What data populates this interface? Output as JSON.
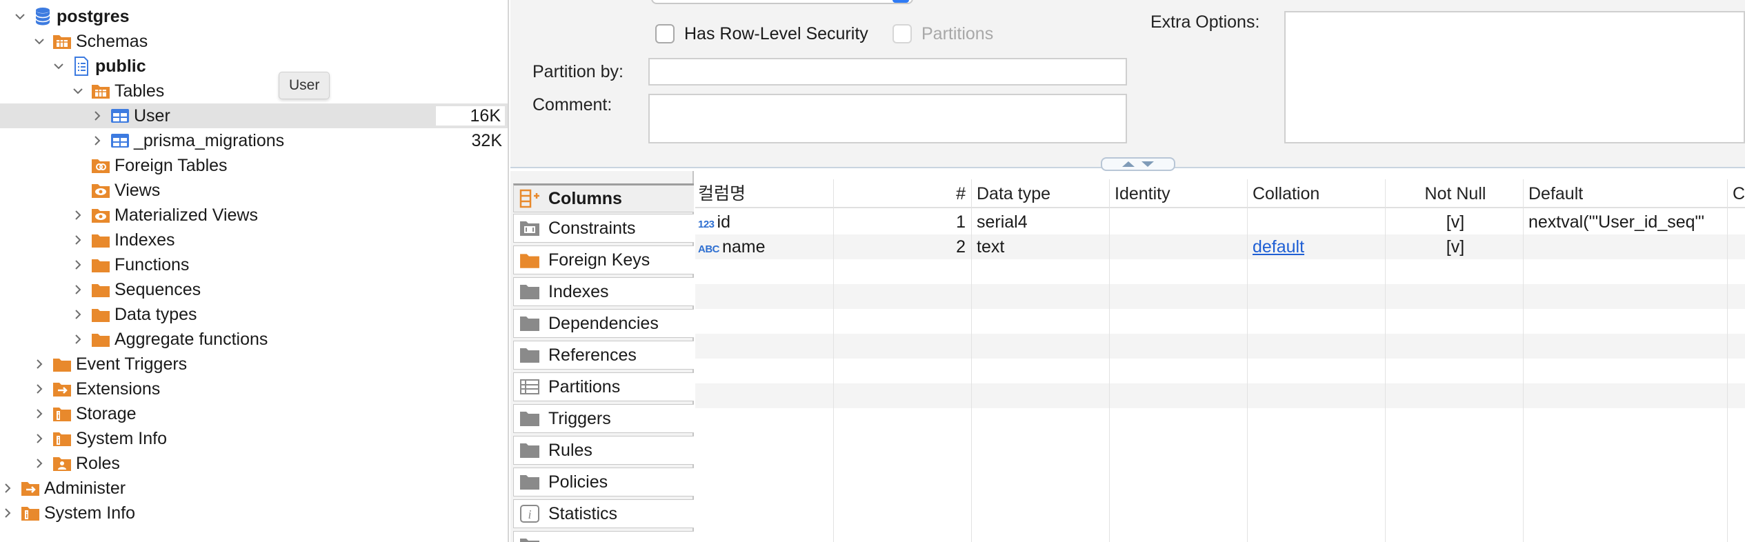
{
  "colors": {
    "folder": "#e8892c",
    "db_blue": "#3d7be0",
    "selected_row": "#e2e2e2",
    "link": "#1f5fd4"
  },
  "tooltip": "User",
  "tree": [
    {
      "label": "postgres",
      "bold": true,
      "icon": "database-icon",
      "chevron": "open"
    },
    {
      "label": "Schemas",
      "icon": "schemas-icon",
      "chevron": "open"
    },
    {
      "label": "public",
      "bold": true,
      "icon": "schema-doc-icon",
      "chevron": "open"
    },
    {
      "label": "Tables",
      "icon": "tables-folder-icon",
      "chevron": "open"
    },
    {
      "label": "User",
      "icon": "table-icon",
      "chevron": "closed",
      "size": "16K",
      "selected": true
    },
    {
      "label": "_prisma_migrations",
      "icon": "table-icon",
      "chevron": "closed",
      "size": "32K"
    },
    {
      "label": "Foreign Tables",
      "icon": "foreign-tables-icon",
      "chevron": "none"
    },
    {
      "label": "Views",
      "icon": "views-icon",
      "chevron": "none"
    },
    {
      "label": "Materialized Views",
      "icon": "materialized-views-icon",
      "chevron": "closed"
    },
    {
      "label": "Indexes",
      "icon": "folder-icon",
      "chevron": "closed"
    },
    {
      "label": "Functions",
      "icon": "folder-icon",
      "chevron": "closed"
    },
    {
      "label": "Sequences",
      "icon": "folder-icon",
      "chevron": "closed"
    },
    {
      "label": "Data types",
      "icon": "folder-icon",
      "chevron": "closed"
    },
    {
      "label": "Aggregate functions",
      "icon": "folder-icon",
      "chevron": "closed"
    },
    {
      "label": "Event Triggers",
      "icon": "folder-icon",
      "chevron": "closed"
    },
    {
      "label": "Extensions",
      "icon": "extensions-icon",
      "chevron": "closed"
    },
    {
      "label": "Storage",
      "icon": "info-folder-icon",
      "chevron": "closed"
    },
    {
      "label": "System Info",
      "icon": "info-folder-icon",
      "chevron": "closed"
    },
    {
      "label": "Roles",
      "icon": "roles-icon",
      "chevron": "closed"
    },
    {
      "label": "Administer",
      "icon": "administer-icon",
      "chevron": "closed"
    },
    {
      "label": "System Info",
      "icon": "info-folder-icon",
      "chevron": "closed"
    }
  ],
  "properties": {
    "has_rls_label": "Has Row-Level Security",
    "partitions_label": "Partitions",
    "extra_options_label": "Extra Options:",
    "partition_by_label": "Partition by:",
    "comment_label": "Comment:",
    "partition_by_value": "",
    "comment_value": "",
    "extra_options_value": ""
  },
  "tabs": [
    {
      "label": "Columns",
      "icon": "columns-icon",
      "active": true
    },
    {
      "label": "Constraints",
      "icon": "constraints-icon"
    },
    {
      "label": "Foreign Keys",
      "icon": "foreign-keys-folder-icon"
    },
    {
      "label": "Indexes",
      "icon": "folder-icon"
    },
    {
      "label": "Dependencies",
      "icon": "folder-icon"
    },
    {
      "label": "References",
      "icon": "folder-icon"
    },
    {
      "label": "Partitions",
      "icon": "partitions-icon"
    },
    {
      "label": "Triggers",
      "icon": "folder-icon"
    },
    {
      "label": "Rules",
      "icon": "folder-icon"
    },
    {
      "label": "Policies",
      "icon": "folder-icon"
    },
    {
      "label": "Statistics",
      "icon": "statistics-icon"
    }
  ],
  "grid": {
    "headers": {
      "name": "컬럼명",
      "num": "#",
      "data_type": "Data type",
      "identity": "Identity",
      "collation": "Collation",
      "not_null": "Not Null",
      "default": "Default",
      "comment": "Co"
    },
    "rows": [
      {
        "type_badge": "123",
        "name": "id",
        "num": "1",
        "data_type": "serial4",
        "identity": "",
        "collation": "",
        "not_null": "[v]",
        "default": "nextval('\"User_id_seq\"'"
      },
      {
        "type_badge": "ABC",
        "name": "name",
        "num": "2",
        "data_type": "text",
        "identity": "",
        "collation": "default",
        "not_null": "[v]",
        "default": ""
      }
    ]
  }
}
